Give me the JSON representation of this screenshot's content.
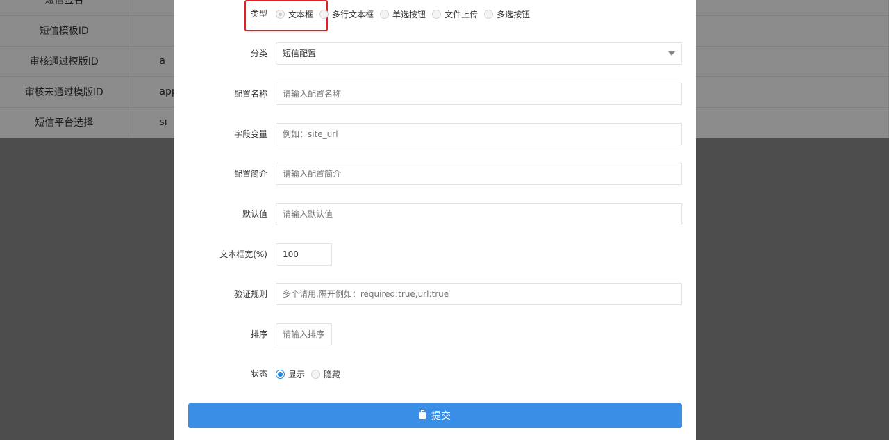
{
  "background_table": {
    "rows": [
      {
        "label": "短信签名",
        "value": ""
      },
      {
        "label": "短信模板ID",
        "value": ""
      },
      {
        "label": "审核通过模版ID",
        "value": "a"
      },
      {
        "label": "审核未通过模版ID",
        "value": "app"
      },
      {
        "label": "短信平台选择",
        "value": "sı"
      }
    ]
  },
  "form": {
    "type": {
      "label": "类型",
      "options": [
        "文本框",
        "多行文本框",
        "单选按钮",
        "文件上传",
        "多选按钮"
      ],
      "selected": "文本框"
    },
    "category": {
      "label": "分类",
      "value": "短信配置"
    },
    "config_name": {
      "label": "配置名称",
      "placeholder": "请输入配置名称"
    },
    "field_variable": {
      "label": "字段变量",
      "placeholder": "例如：site_url"
    },
    "config_desc": {
      "label": "配置简介",
      "placeholder": "请输入配置简介"
    },
    "default_value": {
      "label": "默认值",
      "placeholder": "请输入默认值"
    },
    "text_width": {
      "label": "文本框宽(%)",
      "value": "100"
    },
    "validation": {
      "label": "验证规则",
      "placeholder": "多个请用,隔开例如：required:true,url:true"
    },
    "sort": {
      "label": "排序",
      "placeholder": "请输入排序"
    },
    "status": {
      "label": "状态",
      "options": [
        "显示",
        "隐藏"
      ],
      "selected": "显示"
    },
    "submit_label": "提交"
  },
  "colors": {
    "primary": "#3a8ee6",
    "highlight": "#e02020",
    "radio_checked": "#1e88e5"
  }
}
